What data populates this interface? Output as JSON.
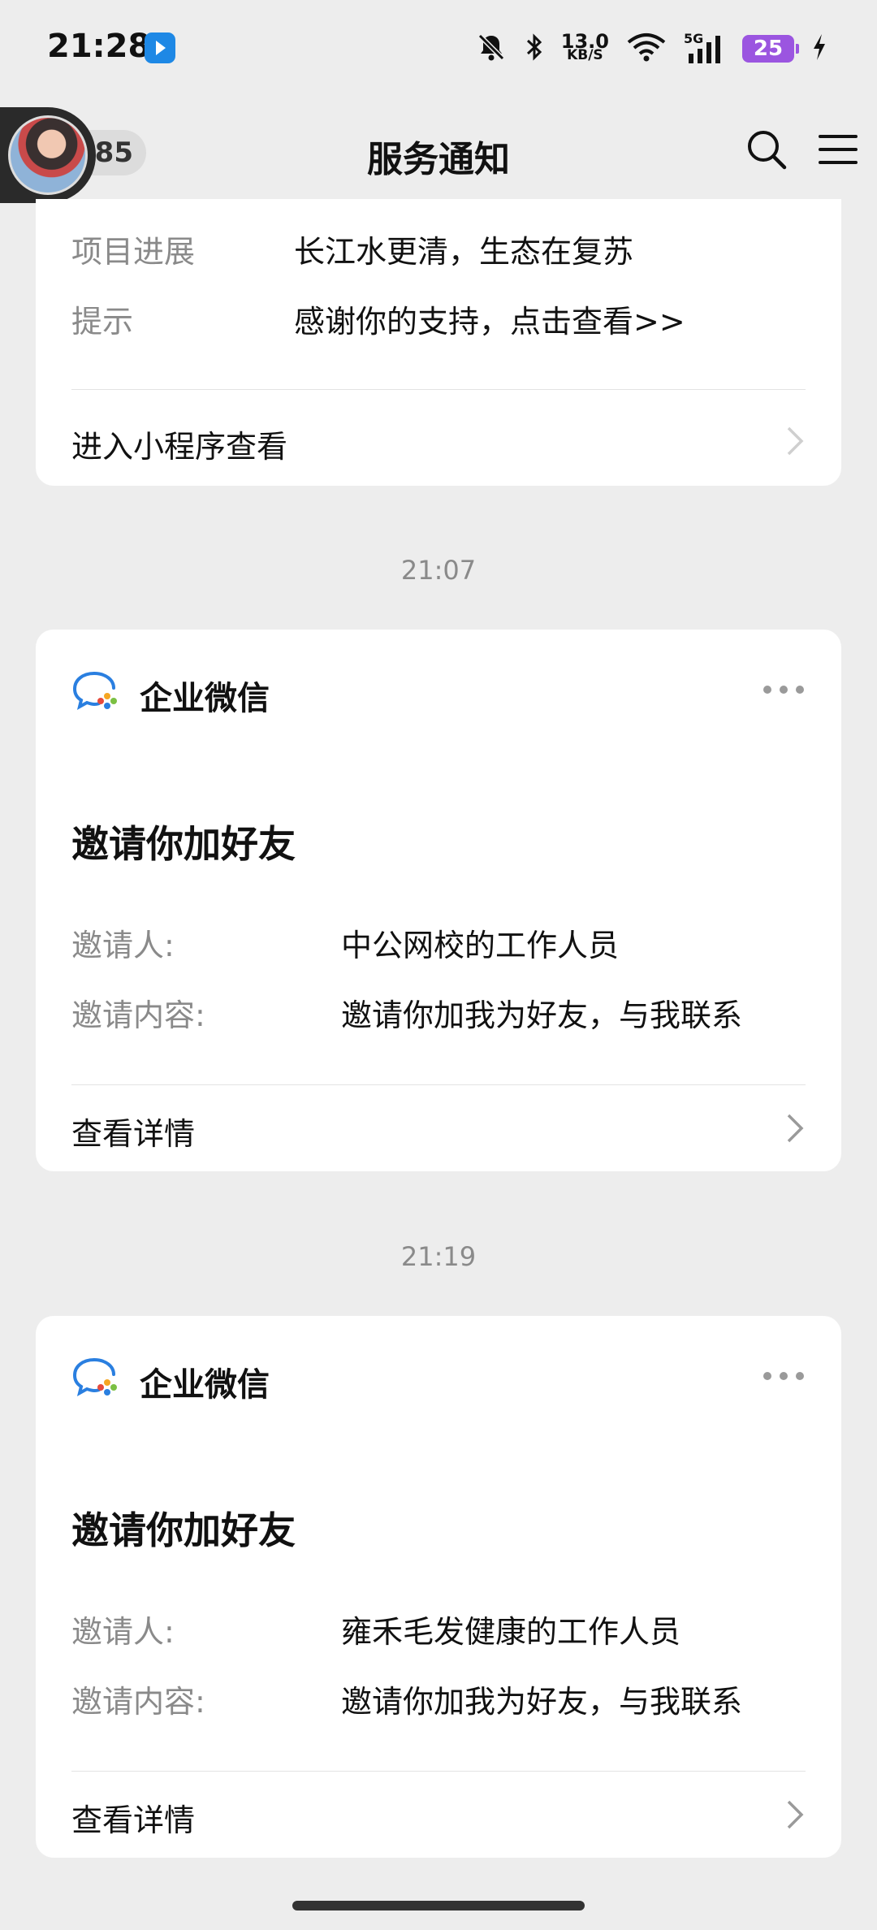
{
  "status_bar": {
    "time": "21:28",
    "network_speed_value": "13.0",
    "network_speed_unit": "KB/S",
    "network_type": "5G",
    "battery_level": "25",
    "icons": [
      "notifications-muted-icon",
      "bluetooth-icon",
      "wifi-icon",
      "cellular-signal-icon",
      "charging-icon"
    ]
  },
  "header": {
    "title": "服务通知",
    "badge_count": "385"
  },
  "cards": [
    {
      "fields": [
        {
          "key": "项目进展",
          "value": "长江水更清，生态在复苏"
        },
        {
          "key": "提示",
          "value": "感谢你的支持，点击查看>>"
        }
      ],
      "link_label": "进入小程序查看"
    },
    {
      "timestamp": "21:07",
      "app_name": "企业微信",
      "title": "邀请你加好友",
      "fields": [
        {
          "key": "邀请人:",
          "value": "中公网校的工作人员"
        },
        {
          "key": "邀请内容:",
          "value": "邀请你加我为好友，与我联系"
        }
      ],
      "link_label": "查看详情"
    },
    {
      "timestamp": "21:19",
      "app_name": "企业微信",
      "title": "邀请你加好友",
      "fields": [
        {
          "key": "邀请人:",
          "value": "雍禾毛发健康的工作人员"
        },
        {
          "key": "邀请内容:",
          "value": "邀请你加我为好友，与我联系"
        }
      ],
      "link_label": "查看详情"
    }
  ],
  "colors": {
    "background": "#ededed",
    "card": "#ffffff",
    "muted_text": "#8a8a8a",
    "battery": "#9b55e0",
    "wecom_blue": "#2a7fe0"
  }
}
